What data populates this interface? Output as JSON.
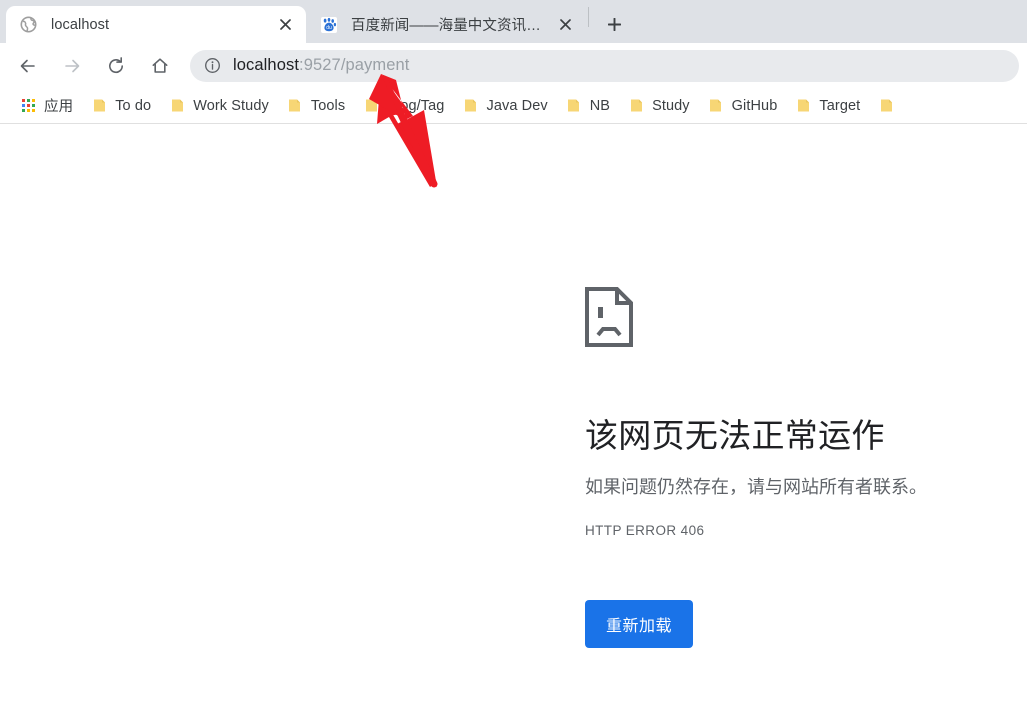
{
  "browser": {
    "tabs": [
      {
        "title": "localhost",
        "favicon": "globe-icon",
        "active": true,
        "close_label": "×"
      },
      {
        "title": "百度新闻——海量中文资讯平台",
        "favicon": "baidu-icon",
        "active": false,
        "close_label": "×"
      }
    ],
    "new_tab_label": "+",
    "nav": {
      "back": "back-arrow-icon",
      "forward": "forward-arrow-icon",
      "reload": "reload-icon",
      "home": "home-icon"
    },
    "omnibox": {
      "info_icon": "info-circle-icon",
      "host": "localhost",
      "path": ":9527/payment",
      "full_url": "localhost:9527/payment"
    },
    "bookmarks": {
      "apps_label": "应用",
      "items": [
        {
          "label": "To do"
        },
        {
          "label": "Work Study"
        },
        {
          "label": "Tools"
        },
        {
          "label": "Blog/Tag"
        },
        {
          "label": "Java Dev"
        },
        {
          "label": "NB"
        },
        {
          "label": "Study"
        },
        {
          "label": "GitHub"
        },
        {
          "label": "Target"
        }
      ]
    }
  },
  "page": {
    "icon": "sad-document-icon",
    "title": "该网页无法正常运作",
    "description": "如果问题仍然存在，请与网站所有者联系。",
    "error_code": "HTTP ERROR 406",
    "reload_button": "重新加载"
  },
  "annotation": {
    "type": "red-arrow",
    "color": "#ee1c25",
    "points_to": "localhost:9527/payment"
  },
  "colors": {
    "accent": "#1a73e8",
    "tabstrip_bg": "#dee1e6",
    "omnibox_bg": "#e8eaed",
    "text_primary": "#202124",
    "text_secondary": "#5f6368",
    "bookmark_folder": "#f7d675"
  }
}
